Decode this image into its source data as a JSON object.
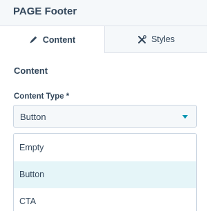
{
  "panel": {
    "title": "PAGE Footer"
  },
  "tabs": [
    {
      "label": "Content",
      "icon": "pencil-icon",
      "active": true
    },
    {
      "label": "Styles",
      "icon": "wrench-screwdriver-icon",
      "active": false
    }
  ],
  "content": {
    "section_title": "Content",
    "content_type": {
      "label": "Content Type *",
      "value": "Button",
      "options": [
        "Empty",
        "Button",
        "CTA"
      ],
      "highlighted": "Button"
    }
  },
  "colors": {
    "accent": "#0091ae",
    "text": "#33475b",
    "highlight": "#e5f5f8",
    "panel_bg": "#f5f8fa",
    "border": "#cbd6e2"
  }
}
